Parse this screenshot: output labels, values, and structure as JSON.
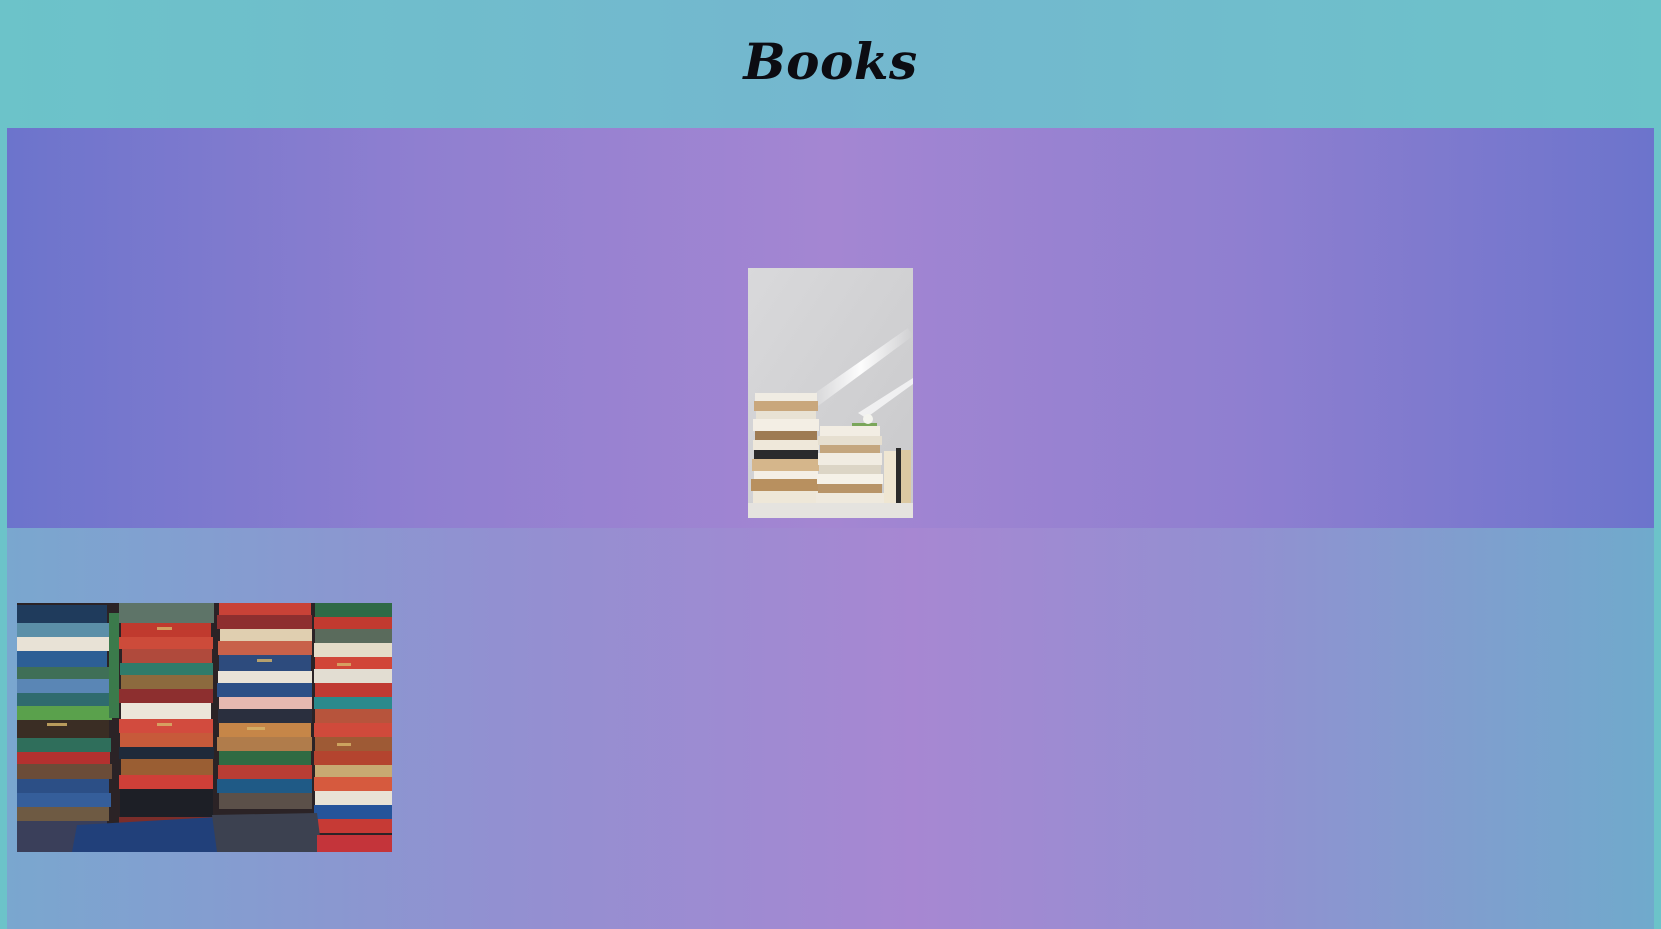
{
  "page": {
    "title": "Books"
  },
  "images": {
    "hero": {
      "subject": "stacked-books-by-window"
    },
    "gallery": {
      "subject": "wall-of-vintage-books"
    }
  },
  "colors": {
    "header_bg": "#6cc3c9",
    "hero_gradient": [
      "#6c74cc",
      "#a486d2"
    ],
    "lower_gradient": [
      "#7aa7cf",
      "#a787d2"
    ],
    "title_text": "#0c0c12"
  }
}
